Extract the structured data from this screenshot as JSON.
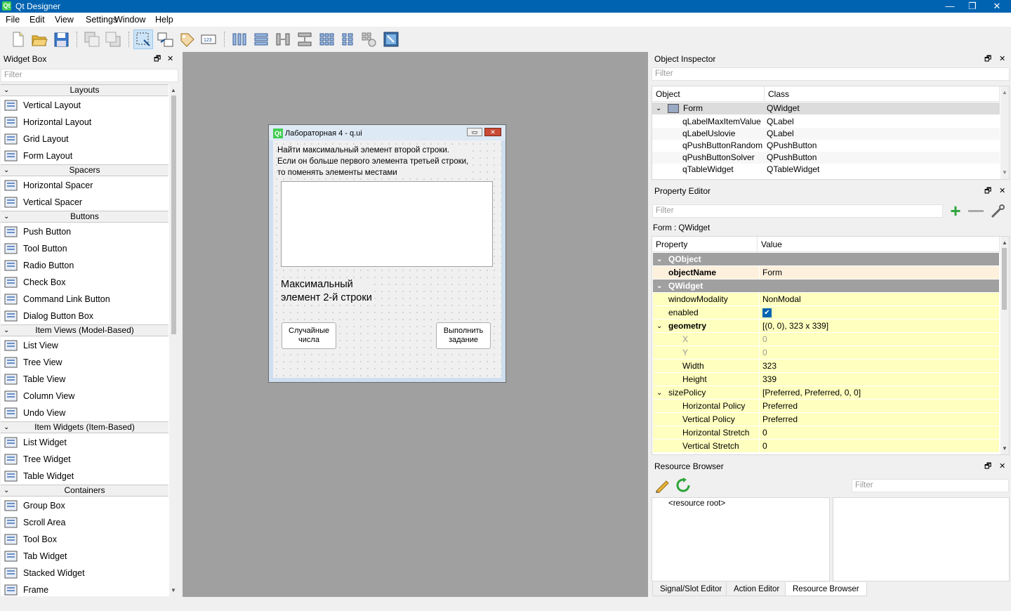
{
  "window": {
    "title": "Qt Designer",
    "app_icon": "Qt",
    "controls": [
      "—",
      "❐",
      "✕"
    ]
  },
  "menu": [
    "File",
    "Edit",
    "View",
    "Settings",
    "Window",
    "Help"
  ],
  "toolbar": [
    "new-file-icon",
    "open-folder-icon",
    "save-icon",
    "send-to-back-icon",
    "bring-to-front-icon",
    "edit-widgets-icon",
    "edit-signals-slots-icon",
    "edit-buddies-icon",
    "edit-tab-order-icon",
    "layout-horizontal-icon",
    "layout-vertical-icon",
    "layout-horizontal-splitter-icon",
    "layout-vertical-splitter-icon",
    "layout-grid-icon",
    "layout-form-icon",
    "break-layout-icon",
    "adjust-size-icon"
  ],
  "widget_box": {
    "title": "Widget Box",
    "filter_placeholder": "Filter",
    "categories": [
      {
        "name": "Layouts",
        "items": [
          "Vertical Layout",
          "Horizontal Layout",
          "Grid Layout",
          "Form Layout"
        ]
      },
      {
        "name": "Spacers",
        "items": [
          "Horizontal Spacer",
          "Vertical Spacer"
        ]
      },
      {
        "name": "Buttons",
        "items": [
          "Push Button",
          "Tool Button",
          "Radio Button",
          "Check Box",
          "Command Link Button",
          "Dialog Button Box"
        ]
      },
      {
        "name": "Item Views (Model-Based)",
        "items": [
          "List View",
          "Tree View",
          "Table View",
          "Column View",
          "Undo View"
        ]
      },
      {
        "name": "Item Widgets (Item-Based)",
        "items": [
          "List Widget",
          "Tree Widget",
          "Table Widget"
        ]
      },
      {
        "name": "Containers",
        "items": [
          "Group Box",
          "Scroll Area",
          "Tool Box",
          "Tab Widget",
          "Stacked Widget",
          "Frame"
        ]
      }
    ]
  },
  "form": {
    "title": "Лабораторная 4 - q.ui",
    "title_icon": "Qt",
    "condition_line1": "Найти максимальный элемент второй строки.",
    "condition_line2": "Если он больше первого элемента третьей строки,",
    "condition_line3": "то поменять элементы местами",
    "max_label_line1": "Максимальный",
    "max_label_line2": "элемент 2-й строки",
    "random_btn_line1": "Случайные",
    "random_btn_line2": "числа",
    "solve_btn_line1": "Выполнить",
    "solve_btn_line2": "задание"
  },
  "object_inspector": {
    "title": "Object Inspector",
    "filter_placeholder": "Filter",
    "col_object": "Object",
    "col_class": "Class",
    "rows": [
      {
        "object": "Form",
        "class": "QWidget"
      },
      {
        "object": "qLabelMaxItemValue",
        "class": "QLabel"
      },
      {
        "object": "qLabelUslovie",
        "class": "QLabel"
      },
      {
        "object": "qPushButtonRandom",
        "class": "QPushButton"
      },
      {
        "object": "qPushButtonSolver",
        "class": "QPushButton"
      },
      {
        "object": "qTableWidget",
        "class": "QTableWidget"
      }
    ]
  },
  "property_editor": {
    "title": "Property Editor",
    "filter_placeholder": "Filter",
    "context": "Form : QWidget",
    "col_property": "Property",
    "col_value": "Value",
    "rows": [
      {
        "name": "QObject",
        "value": "",
        "kind": "section"
      },
      {
        "name": "objectName",
        "value": "Form",
        "kind": "bold-orange"
      },
      {
        "name": "QWidget",
        "value": "",
        "kind": "section"
      },
      {
        "name": "windowModality",
        "value": "NonModal",
        "kind": "normal"
      },
      {
        "name": "enabled",
        "value": "✔",
        "kind": "check"
      },
      {
        "name": "geometry",
        "value": "[(0, 0), 323 x 339]",
        "kind": "bold-expand"
      },
      {
        "name": "X",
        "value": "0",
        "kind": "sub-gray"
      },
      {
        "name": "Y",
        "value": "0",
        "kind": "sub-gray"
      },
      {
        "name": "Width",
        "value": "323",
        "kind": "sub"
      },
      {
        "name": "Height",
        "value": "339",
        "kind": "sub"
      },
      {
        "name": "sizePolicy",
        "value": "[Preferred, Preferred, 0, 0]",
        "kind": "expand"
      },
      {
        "name": "Horizontal Policy",
        "value": "Preferred",
        "kind": "sub"
      },
      {
        "name": "Vertical Policy",
        "value": "Preferred",
        "kind": "sub"
      },
      {
        "name": "Horizontal Stretch",
        "value": "0",
        "kind": "sub"
      },
      {
        "name": "Vertical Stretch",
        "value": "0",
        "kind": "sub"
      }
    ]
  },
  "resource_browser": {
    "title": "Resource Browser",
    "filter_placeholder": "Filter",
    "root": "<resource root>"
  },
  "bottom_tabs": [
    "Signal/Slot Editor",
    "Action Editor",
    "Resource Browser"
  ]
}
